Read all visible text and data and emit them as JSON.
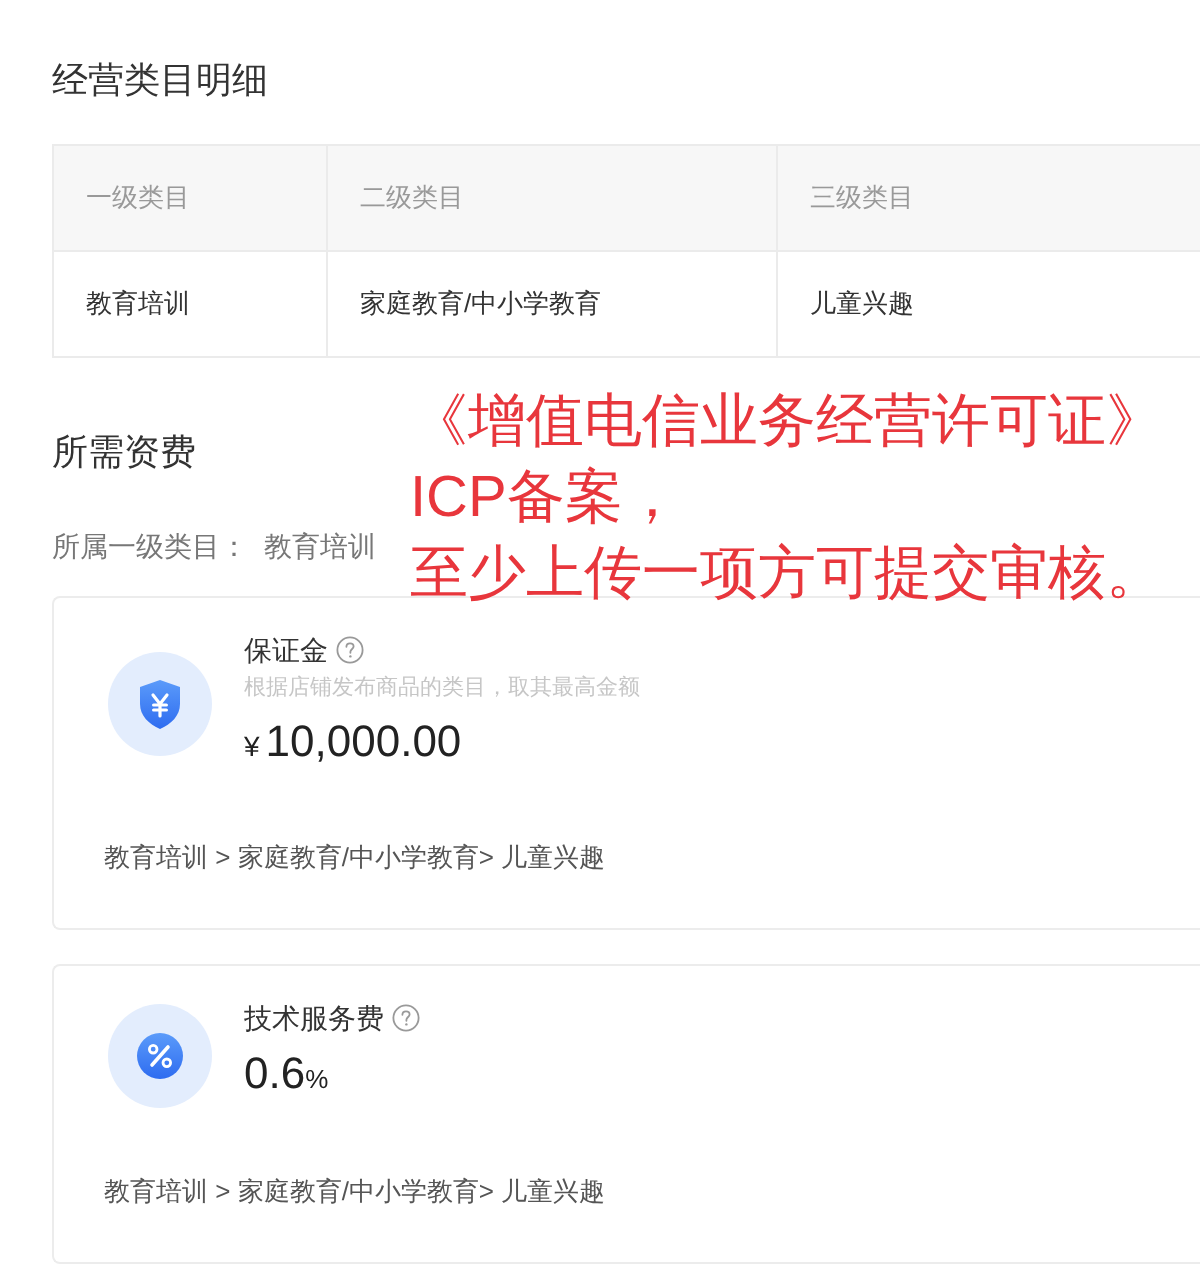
{
  "category_detail": {
    "title": "经营类目明细",
    "table": {
      "columns": [
        "一级类目",
        "二级类目",
        "三级类目"
      ],
      "rows": [
        [
          "教育培训",
          "家庭教育/中小学教育",
          "儿童兴趣"
        ]
      ]
    }
  },
  "fees": {
    "title": "所需资费",
    "category_label": "所属一级类目：",
    "category_value": "教育培训",
    "items": [
      {
        "kind": "deposit",
        "title": "保证金",
        "hint": "根据店铺发布商品的类目，取其最高金额",
        "prefix": "¥",
        "value": "10,000.00",
        "path": "教育培训 > 家庭教育/中小学教育> 儿童兴趣"
      },
      {
        "kind": "rate",
        "title": "技术服务费",
        "value": "0.6",
        "suffix": "%",
        "path": "教育培训 > 家庭教育/中小学教育> 儿童兴趣"
      }
    ]
  },
  "annotation": {
    "lines": [
      "《增值电信业务经营许可证》",
      "ICP备案，",
      "至少上传一项方可提交审核。"
    ]
  }
}
